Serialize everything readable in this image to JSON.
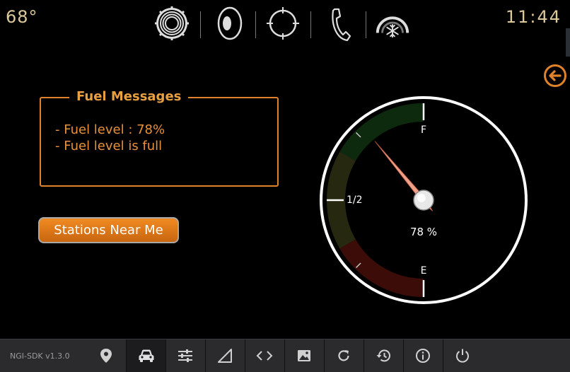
{
  "header": {
    "temperature": "68°",
    "time": "11:44",
    "icons": [
      "settings-gear-icon",
      "speaker-icon",
      "navigation-compass-icon",
      "phone-icon",
      "climate-fan-icon"
    ]
  },
  "fuel_messages": {
    "title": "Fuel Messages",
    "lines": [
      "- Fuel level : 78%",
      "- Fuel level is full"
    ]
  },
  "stations_button": {
    "label": "Stations Near Me"
  },
  "gauge": {
    "full_label": "F",
    "half_label": "1/2",
    "empty_label": "E",
    "fuel_level_percent": 78,
    "readout": "78 %"
  },
  "footer": {
    "version": "NGI-SDK v1.3.0",
    "buttons": [
      "location-pin-icon",
      "car-icon",
      "sliders-icon",
      "signal-icon",
      "code-icon",
      "image-icon",
      "refresh-icon",
      "history-icon",
      "info-icon",
      "power-icon"
    ],
    "active": "car-icon"
  },
  "colors": {
    "accent": "#e0822a",
    "gauge_ring": "#ffffff",
    "zone_full": "#0e2a0e",
    "zone_half": "#262910",
    "zone_empty": "#3c0c08",
    "needle": "#f0a088"
  }
}
